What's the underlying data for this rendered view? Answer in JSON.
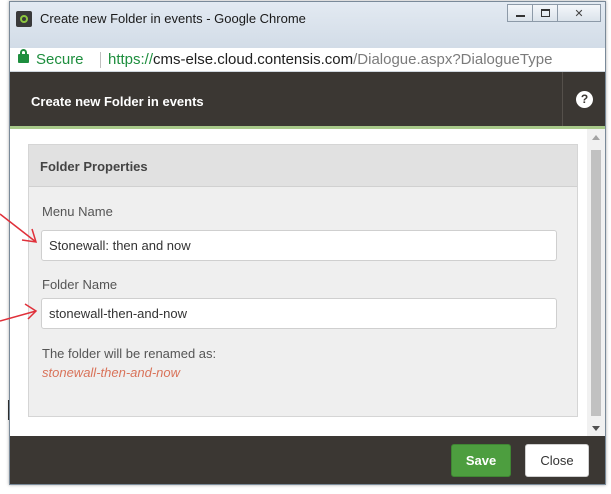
{
  "browser": {
    "window_title": "Create new Folder in events - Google Chrome",
    "secure_label": "Secure",
    "url_scheme": "https://",
    "url_host": "cms-else.cloud.contensis.com",
    "url_path": "/Dialogue.aspx?DialogueType"
  },
  "dialog": {
    "title": "Create new Folder in events",
    "help_label": "?"
  },
  "panel": {
    "title": "Folder Properties",
    "menu_name_label": "Menu Name",
    "menu_name_value": "Stonewall: then and now",
    "folder_name_label": "Folder Name",
    "folder_name_value": "stonewall-then-and-now",
    "rename_text": "The folder will be renamed as:",
    "rename_value": "stonewall-then-and-now"
  },
  "footer": {
    "save_label": "Save",
    "close_label": "Close"
  },
  "colors": {
    "header_bg": "#3b3733",
    "accent_green": "#4d9e3f",
    "rename_text": "#d9735a",
    "annotation_arrow": "#e0303a"
  }
}
